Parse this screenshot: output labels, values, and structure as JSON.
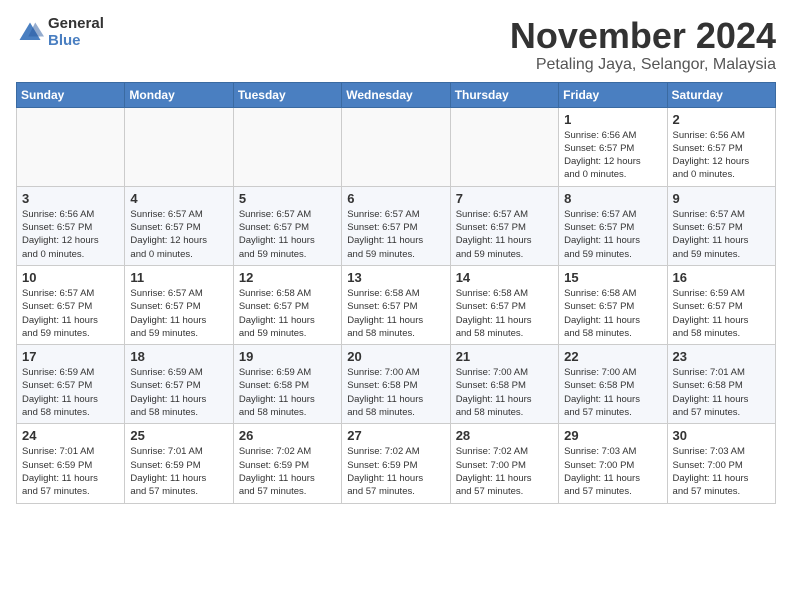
{
  "logo": {
    "general": "General",
    "blue": "Blue"
  },
  "header": {
    "month": "November 2024",
    "location": "Petaling Jaya, Selangor, Malaysia"
  },
  "weekdays": [
    "Sunday",
    "Monday",
    "Tuesday",
    "Wednesday",
    "Thursday",
    "Friday",
    "Saturday"
  ],
  "weeks": [
    [
      {
        "day": "",
        "info": ""
      },
      {
        "day": "",
        "info": ""
      },
      {
        "day": "",
        "info": ""
      },
      {
        "day": "",
        "info": ""
      },
      {
        "day": "",
        "info": ""
      },
      {
        "day": "1",
        "info": "Sunrise: 6:56 AM\nSunset: 6:57 PM\nDaylight: 12 hours\nand 0 minutes."
      },
      {
        "day": "2",
        "info": "Sunrise: 6:56 AM\nSunset: 6:57 PM\nDaylight: 12 hours\nand 0 minutes."
      }
    ],
    [
      {
        "day": "3",
        "info": "Sunrise: 6:56 AM\nSunset: 6:57 PM\nDaylight: 12 hours\nand 0 minutes."
      },
      {
        "day": "4",
        "info": "Sunrise: 6:57 AM\nSunset: 6:57 PM\nDaylight: 12 hours\nand 0 minutes."
      },
      {
        "day": "5",
        "info": "Sunrise: 6:57 AM\nSunset: 6:57 PM\nDaylight: 11 hours\nand 59 minutes."
      },
      {
        "day": "6",
        "info": "Sunrise: 6:57 AM\nSunset: 6:57 PM\nDaylight: 11 hours\nand 59 minutes."
      },
      {
        "day": "7",
        "info": "Sunrise: 6:57 AM\nSunset: 6:57 PM\nDaylight: 11 hours\nand 59 minutes."
      },
      {
        "day": "8",
        "info": "Sunrise: 6:57 AM\nSunset: 6:57 PM\nDaylight: 11 hours\nand 59 minutes."
      },
      {
        "day": "9",
        "info": "Sunrise: 6:57 AM\nSunset: 6:57 PM\nDaylight: 11 hours\nand 59 minutes."
      }
    ],
    [
      {
        "day": "10",
        "info": "Sunrise: 6:57 AM\nSunset: 6:57 PM\nDaylight: 11 hours\nand 59 minutes."
      },
      {
        "day": "11",
        "info": "Sunrise: 6:57 AM\nSunset: 6:57 PM\nDaylight: 11 hours\nand 59 minutes."
      },
      {
        "day": "12",
        "info": "Sunrise: 6:58 AM\nSunset: 6:57 PM\nDaylight: 11 hours\nand 59 minutes."
      },
      {
        "day": "13",
        "info": "Sunrise: 6:58 AM\nSunset: 6:57 PM\nDaylight: 11 hours\nand 58 minutes."
      },
      {
        "day": "14",
        "info": "Sunrise: 6:58 AM\nSunset: 6:57 PM\nDaylight: 11 hours\nand 58 minutes."
      },
      {
        "day": "15",
        "info": "Sunrise: 6:58 AM\nSunset: 6:57 PM\nDaylight: 11 hours\nand 58 minutes."
      },
      {
        "day": "16",
        "info": "Sunrise: 6:59 AM\nSunset: 6:57 PM\nDaylight: 11 hours\nand 58 minutes."
      }
    ],
    [
      {
        "day": "17",
        "info": "Sunrise: 6:59 AM\nSunset: 6:57 PM\nDaylight: 11 hours\nand 58 minutes."
      },
      {
        "day": "18",
        "info": "Sunrise: 6:59 AM\nSunset: 6:57 PM\nDaylight: 11 hours\nand 58 minutes."
      },
      {
        "day": "19",
        "info": "Sunrise: 6:59 AM\nSunset: 6:58 PM\nDaylight: 11 hours\nand 58 minutes."
      },
      {
        "day": "20",
        "info": "Sunrise: 7:00 AM\nSunset: 6:58 PM\nDaylight: 11 hours\nand 58 minutes."
      },
      {
        "day": "21",
        "info": "Sunrise: 7:00 AM\nSunset: 6:58 PM\nDaylight: 11 hours\nand 58 minutes."
      },
      {
        "day": "22",
        "info": "Sunrise: 7:00 AM\nSunset: 6:58 PM\nDaylight: 11 hours\nand 57 minutes."
      },
      {
        "day": "23",
        "info": "Sunrise: 7:01 AM\nSunset: 6:58 PM\nDaylight: 11 hours\nand 57 minutes."
      }
    ],
    [
      {
        "day": "24",
        "info": "Sunrise: 7:01 AM\nSunset: 6:59 PM\nDaylight: 11 hours\nand 57 minutes."
      },
      {
        "day": "25",
        "info": "Sunrise: 7:01 AM\nSunset: 6:59 PM\nDaylight: 11 hours\nand 57 minutes."
      },
      {
        "day": "26",
        "info": "Sunrise: 7:02 AM\nSunset: 6:59 PM\nDaylight: 11 hours\nand 57 minutes."
      },
      {
        "day": "27",
        "info": "Sunrise: 7:02 AM\nSunset: 6:59 PM\nDaylight: 11 hours\nand 57 minutes."
      },
      {
        "day": "28",
        "info": "Sunrise: 7:02 AM\nSunset: 7:00 PM\nDaylight: 11 hours\nand 57 minutes."
      },
      {
        "day": "29",
        "info": "Sunrise: 7:03 AM\nSunset: 7:00 PM\nDaylight: 11 hours\nand 57 minutes."
      },
      {
        "day": "30",
        "info": "Sunrise: 7:03 AM\nSunset: 7:00 PM\nDaylight: 11 hours\nand 57 minutes."
      }
    ]
  ]
}
